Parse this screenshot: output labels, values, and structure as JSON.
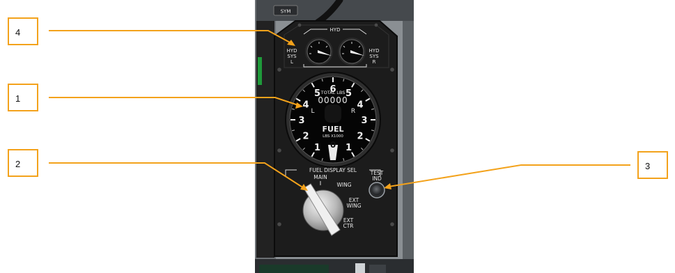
{
  "callouts": [
    {
      "label": "4",
      "target": "hydraulic-pressure-gauges"
    },
    {
      "label": "1",
      "target": "fuel-quantity-indicator"
    },
    {
      "label": "2",
      "target": "fuel-display-selector"
    },
    {
      "label": "3",
      "target": "test-indicator-button"
    }
  ],
  "panel": {
    "sym_label": "SYM",
    "hyd_title": "HYD",
    "hyd_left": {
      "line1": "HYD",
      "line2": "SYS",
      "line3": "L"
    },
    "hyd_right": {
      "line1": "HYD",
      "line2": "SYS",
      "line3": "R"
    },
    "fuel_gauge": {
      "total_label": "TOTAL LBS",
      "total_value": "00000",
      "side_left": "L",
      "side_right": "R",
      "title": "FUEL",
      "units": "LBS X1000",
      "scale_left": [
        "6",
        "5",
        "4",
        "3",
        "2",
        "1"
      ],
      "scale_right": [
        "5",
        "4",
        "3",
        "2",
        "1"
      ],
      "zero": "0",
      "pointer_value": 0
    },
    "selector": {
      "title": "FUEL DISPLAY SEL",
      "positions": [
        "MAIN",
        "WING",
        "EXT WING",
        "EXT CTR"
      ],
      "ext_wing": {
        "line1": "EXT",
        "line2": "WING"
      },
      "ext_ctr": {
        "line1": "EXT",
        "line2": "CTR"
      },
      "selected": "MAIN"
    },
    "test_button": {
      "line1": "TEST",
      "line2": "IND"
    }
  },
  "colors": {
    "callout_orange": "#f3a21b",
    "panel_black": "#1c1c1c",
    "panel_text": "#e8e8e8"
  }
}
